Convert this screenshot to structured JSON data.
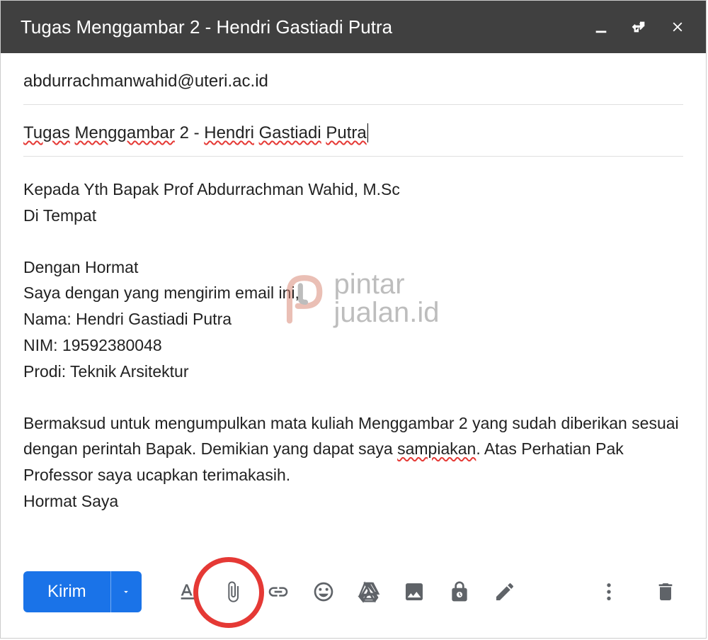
{
  "header": {
    "title": "Tugas Menggambar 2 - Hendri Gastiadi Putra"
  },
  "fields": {
    "recipient": "abdurrachmanwahid@uteri.ac.id",
    "subject_words": [
      "Tugas",
      " ",
      "Menggambar",
      " 2 - ",
      "Hendri",
      " ",
      "Gastiadi",
      " ",
      "Putra"
    ]
  },
  "body": {
    "salutation1": "Kepada Yth Bapak Prof Abdurrachman Wahid, M.Sc",
    "salutation2": "Di Tempat",
    "opening": "Dengan Hormat",
    "intro": "Saya dengan yang mengirim email ini,",
    "name": "Nama: Hendri Gastiadi Putra",
    "nim": "NIM: 19592380048",
    "prodi": "Prodi: Teknik Arsitektur",
    "para_a": "Bermaksud untuk mengumpulkan mata kuliah Menggambar 2 yang sudah diberikan sesuai dengan perintah Bapak. Demikian yang dapat saya ",
    "misspell": "sampiakan",
    "para_b": ". Atas Perhatian Pak Professor saya ucapkan terimakasih.",
    "closing": "Hormat Saya"
  },
  "toolbar": {
    "send_label": "Kirim"
  },
  "watermark": {
    "line1": "pintar",
    "line2": "jualan.id"
  },
  "icons": {
    "minimize": "minimize-icon",
    "fullscreen": "fullscreen-icon",
    "close": "close-icon",
    "format": "format-icon",
    "attach": "attach-icon",
    "link": "link-icon",
    "emoji": "emoji-icon",
    "drive": "drive-icon",
    "photo": "photo-icon",
    "confidential": "confidential-icon",
    "pen": "pen-icon",
    "more": "more-icon",
    "trash": "trash-icon"
  }
}
